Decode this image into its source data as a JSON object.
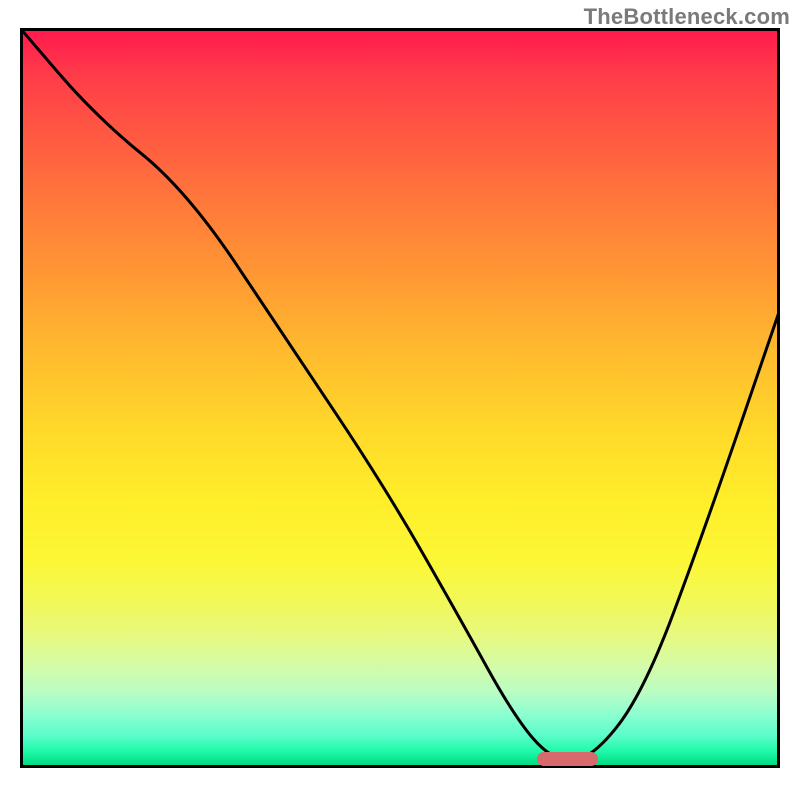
{
  "watermark": "TheBottleneck.com",
  "chart_data": {
    "type": "line",
    "title": "",
    "xlabel": "",
    "ylabel": "",
    "xlim": [
      0,
      100
    ],
    "ylim": [
      0,
      100
    ],
    "grid": false,
    "legend": false,
    "series": [
      {
        "name": "bottleneck-curve",
        "x": [
          0,
          10,
          22,
          35,
          48,
          58,
          65,
          70,
          75,
          82,
          90,
          100
        ],
        "values": [
          100,
          88,
          78,
          58,
          38,
          20,
          7,
          1,
          1,
          10,
          32,
          62
        ]
      }
    ],
    "marker": {
      "x_start": 68,
      "x_end": 76,
      "y": 1,
      "color": "#d86a6e"
    },
    "background": {
      "type": "vertical-gradient",
      "description": "red (top, high bottleneck) through orange and yellow to green (bottom, optimal)",
      "stops": [
        {
          "pos": 0,
          "color": "#ff1a4d"
        },
        {
          "pos": 50,
          "color": "#ffd82a"
        },
        {
          "pos": 100,
          "color": "#00d87f"
        }
      ]
    }
  }
}
